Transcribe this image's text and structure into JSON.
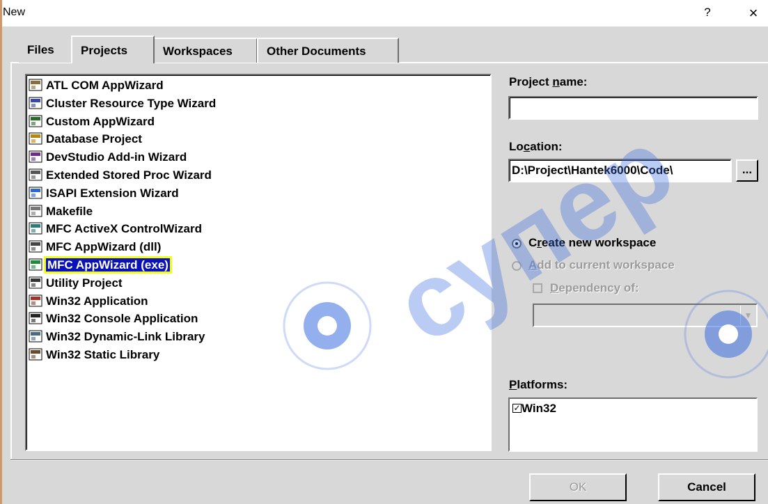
{
  "window": {
    "title": "New",
    "help_glyph": "?",
    "close_glyph": "×"
  },
  "tabs": [
    {
      "label": "Files",
      "active": false
    },
    {
      "label": "Projects",
      "active": true
    },
    {
      "label": "Workspaces",
      "active": false
    },
    {
      "label": "Other Documents",
      "active": false
    }
  ],
  "projects": {
    "selected_index": 10,
    "items": [
      {
        "label": "ATL COM AppWizard",
        "icon": "atl-wizard-icon"
      },
      {
        "label": "Cluster Resource Type Wizard",
        "icon": "cluster-wizard-icon"
      },
      {
        "label": "Custom AppWizard",
        "icon": "custom-wizard-icon"
      },
      {
        "label": "Database Project",
        "icon": "database-icon"
      },
      {
        "label": "DevStudio Add-in Wizard",
        "icon": "addin-wizard-icon"
      },
      {
        "label": "Extended Stored Proc Wizard",
        "icon": "stored-proc-icon"
      },
      {
        "label": "ISAPI Extension Wizard",
        "icon": "globe-icon"
      },
      {
        "label": "Makefile",
        "icon": "makefile-icon"
      },
      {
        "label": "MFC ActiveX ControlWizard",
        "icon": "activex-icon"
      },
      {
        "label": "MFC AppWizard (dll)",
        "icon": "mfc-dll-icon"
      },
      {
        "label": "MFC AppWizard (exe)",
        "icon": "mfc-exe-icon"
      },
      {
        "label": "Utility Project",
        "icon": "utility-icon"
      },
      {
        "label": "Win32 Application",
        "icon": "win32-app-icon"
      },
      {
        "label": "Win32 Console Application",
        "icon": "console-icon"
      },
      {
        "label": "Win32 Dynamic-Link Library",
        "icon": "dll-icon"
      },
      {
        "label": "Win32 Static Library",
        "icon": "static-lib-icon"
      }
    ]
  },
  "project_name": {
    "label_pre": "Project ",
    "label_key": "n",
    "label_post": "ame:",
    "value": ""
  },
  "location": {
    "label_pre": "Lo",
    "label_key": "c",
    "label_post": "ation:",
    "value": "D:\\Project\\Hantek6000\\Code\\",
    "browse_label": "..."
  },
  "workspace": {
    "create_pre": "C",
    "create_key": "r",
    "create_post": "eate new workspace",
    "add_key": "A",
    "add_post": "dd to current workspace",
    "dependency_key": "D",
    "dependency_post": "ependency of:",
    "create_selected": true
  },
  "platforms": {
    "label_key": "P",
    "label_post": "latforms:",
    "items": [
      {
        "label": "Win32",
        "checked": true
      }
    ]
  },
  "buttons": {
    "ok": "OK",
    "cancel": "Cancel"
  },
  "watermark": {
    "text": "супер",
    "color": "#3b6de0"
  },
  "colors": {
    "selection_bg": "#0a12b8",
    "highlight": "#f1ff18",
    "dialog_bg": "#d8d8d8"
  }
}
